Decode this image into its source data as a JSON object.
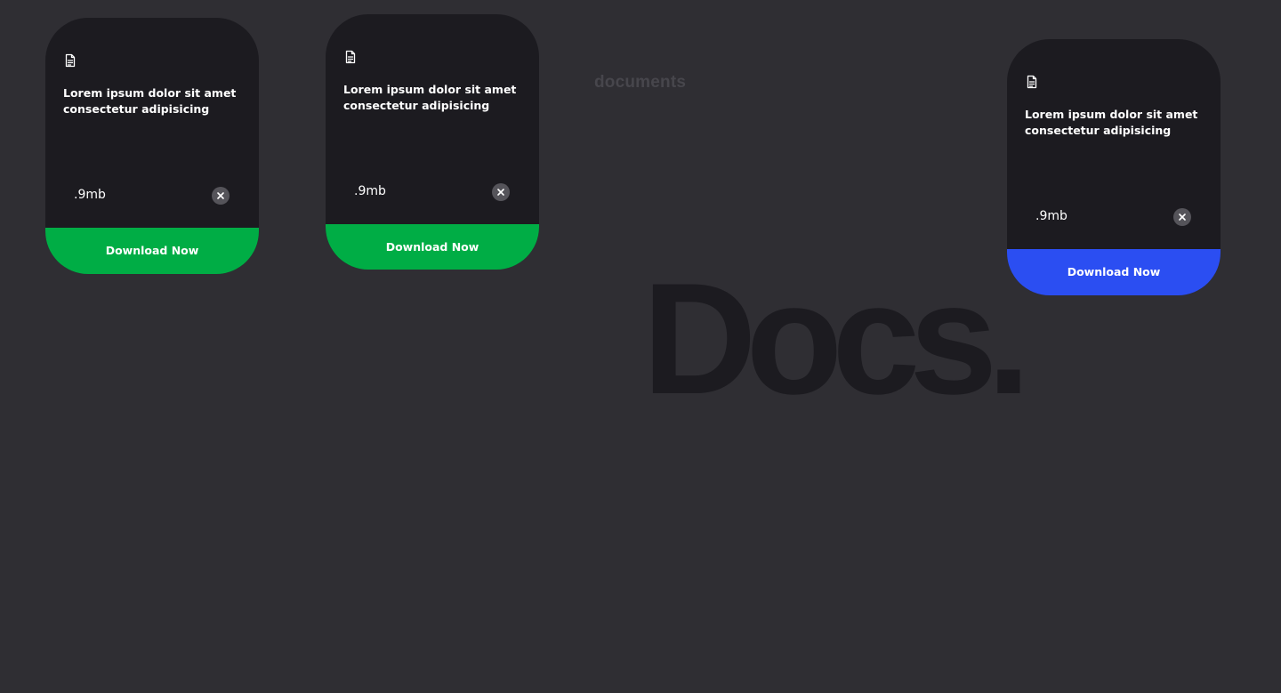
{
  "section_label": "documents",
  "brand": "Docs.",
  "colors": {
    "background": "#2f2e33",
    "card": "#1c1b20",
    "green": "#00ad45",
    "blue": "#2b4ef2",
    "close_circle": "#55545a"
  },
  "cards": [
    {
      "icon": "document-icon",
      "title": "Lorem ipsum dolor sit amet consectetur adipisicing",
      "size": ".9mb",
      "close_icon": "close-icon",
      "button_label": "Download Now",
      "button_color": "#00ad45"
    },
    {
      "icon": "document-icon",
      "title": "Lorem ipsum dolor sit amet consectetur adipisicing",
      "size": ".9mb",
      "close_icon": "close-icon",
      "button_label": "Download Now",
      "button_color": "#00ad45"
    },
    {
      "icon": "document-icon",
      "title": "Lorem ipsum dolor sit amet consectetur adipisicing",
      "size": ".9mb",
      "close_icon": "close-icon",
      "button_label": "Download Now",
      "button_color": "#2b4ef2"
    }
  ]
}
